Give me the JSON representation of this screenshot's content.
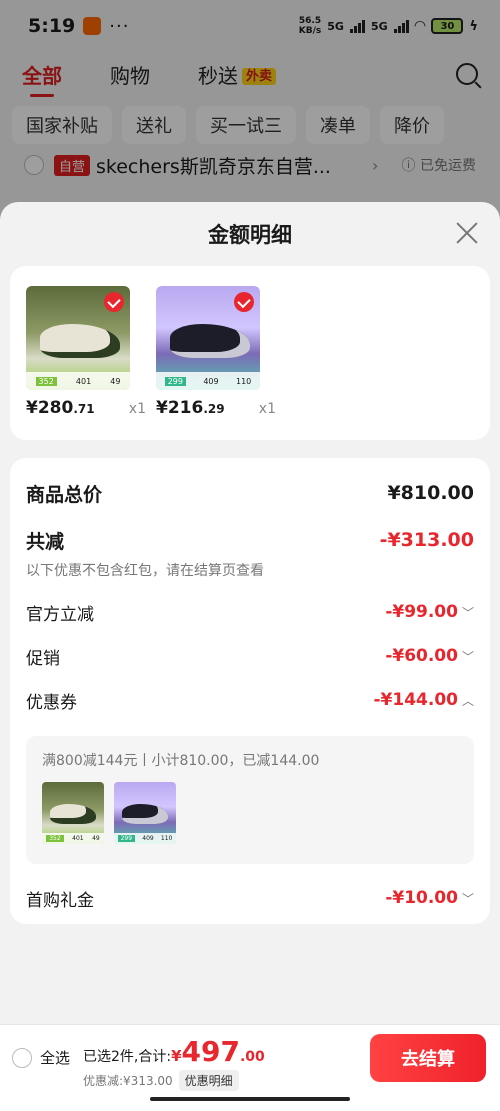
{
  "status_bar": {
    "time": "5:19",
    "speed_top": "56.5",
    "speed_bottom": "KB/s",
    "signal_1": "5G",
    "signal_2": "5G",
    "battery": "30"
  },
  "top_tabs": [
    {
      "label": "全部"
    },
    {
      "label": "购物"
    },
    {
      "label": "秒送",
      "badge": "外卖"
    }
  ],
  "filters": [
    "国家补贴",
    "送礼",
    "买一试三",
    "凑单",
    "降价"
  ],
  "shop": {
    "badge": "自营",
    "name": "skechers斯凯奇京东自营...",
    "shipping": "已免运费"
  },
  "sheet": {
    "title": "金额明细"
  },
  "products": [
    {
      "price_int": "¥280",
      "price_dec": ".71",
      "qty": "x1",
      "strip": [
        "352",
        "401",
        "49"
      ]
    },
    {
      "price_int": "¥216",
      "price_dec": ".29",
      "qty": "x1",
      "strip": [
        "299",
        "409",
        "110"
      ]
    }
  ],
  "breakdown": {
    "total_label": "商品总价",
    "total_value": "¥810.00",
    "discount_label": "共减",
    "discount_value": "-¥313.00",
    "discount_note": "以下优惠不包含红包，请在结算页查看",
    "official_label": "官方立减",
    "official_value": "-¥99.00",
    "promo_label": "促销",
    "promo_value": "-¥60.00",
    "coupon_label": "优惠券",
    "coupon_value": "-¥144.00",
    "coupon_detail": "满800减144元丨小计810.00，已减144.00",
    "first_label": "首购礼金",
    "first_value": "-¥10.00"
  },
  "bottom_bar": {
    "select_all": "全选",
    "selected_text": "已选2件,合计:",
    "currency": "¥",
    "total_int": "497",
    "total_dec": ".00",
    "saved_text": "优惠减:¥313.00",
    "detail_button": "优惠明细",
    "checkout": "去结算"
  },
  "colors": {
    "accent": "#e8262d",
    "badge_yellow": "#ffd21a"
  },
  "icons": [
    "search-icon",
    "close-icon",
    "check-icon",
    "chevron-down-icon",
    "chevron-up-icon",
    "chevron-right-icon",
    "info-icon"
  ]
}
